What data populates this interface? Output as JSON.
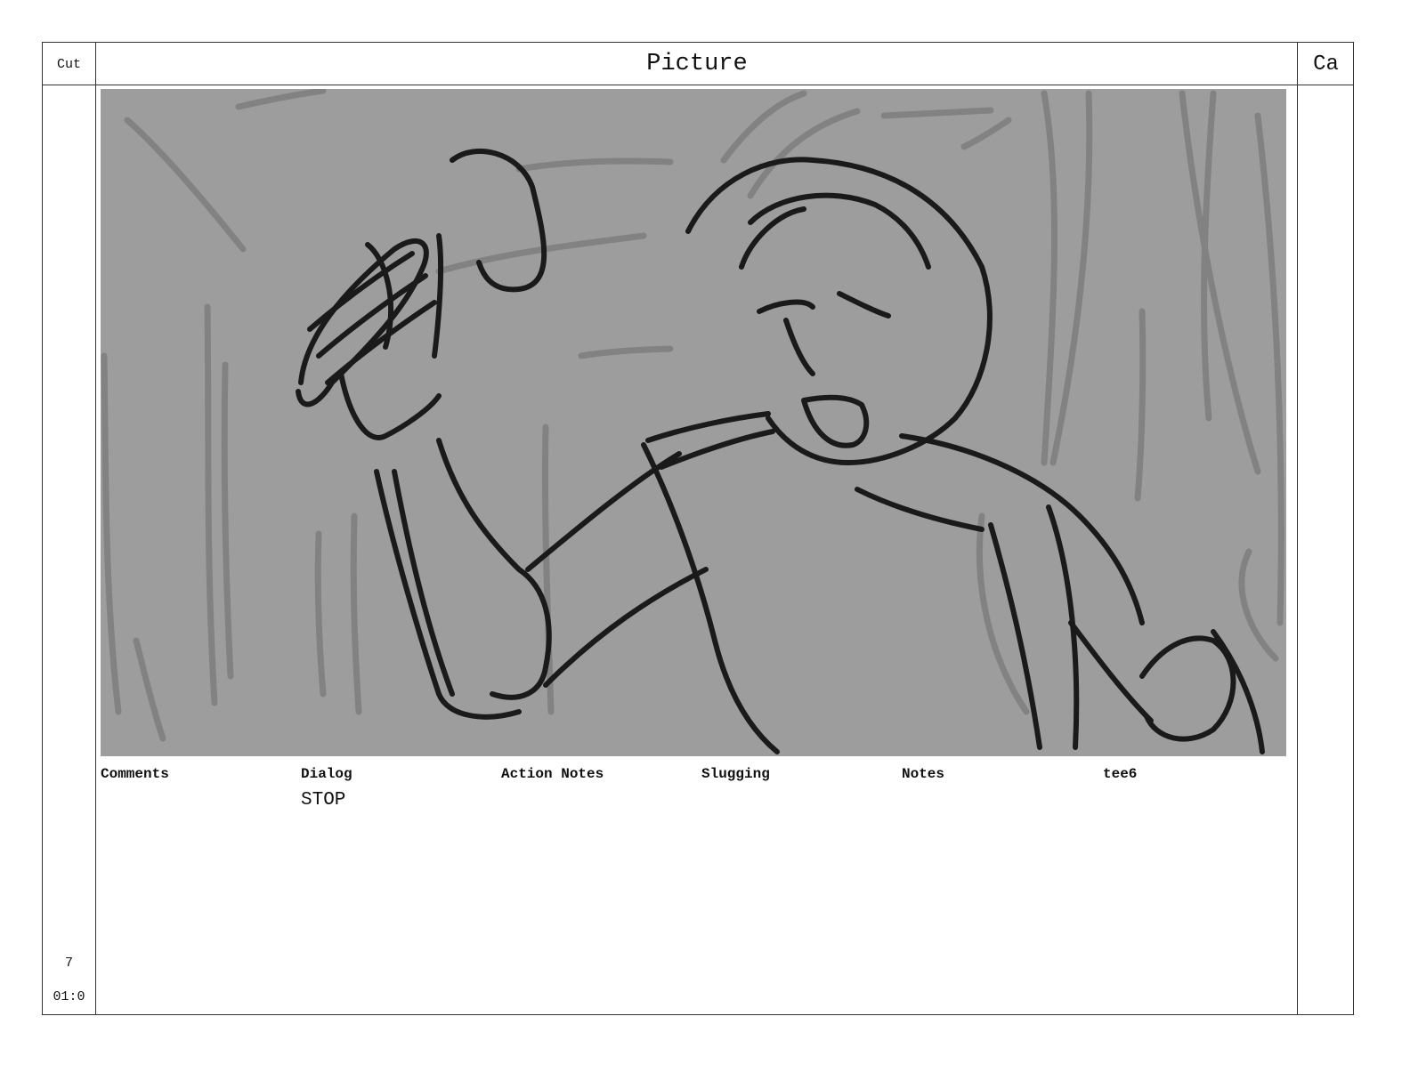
{
  "header": {
    "cut_label": "Cut",
    "picture_label": "Picture",
    "camera_label": "Ca"
  },
  "cut": {
    "number": "7",
    "duration": "01:0"
  },
  "fields": {
    "comments": {
      "label": "Comments",
      "value": ""
    },
    "dialog": {
      "label": "Dialog",
      "value": "STOP"
    },
    "action_notes": {
      "label": "Action Notes",
      "value": ""
    },
    "slugging": {
      "label": "Slugging",
      "value": ""
    },
    "notes": {
      "label": "Notes",
      "value": ""
    },
    "tee6": {
      "label": "tee6",
      "value": ""
    }
  },
  "panel": {
    "background_color": "#9d9d9d",
    "line_color": "#1a1a1a",
    "bg_line_color": "#7c7c7c"
  }
}
